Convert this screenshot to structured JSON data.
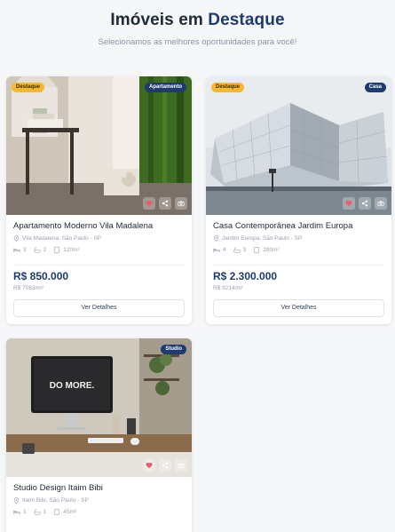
{
  "header": {
    "title_part1": "Imóveis em",
    "title_part2": "Destaque",
    "subtitle": "Selecionamos as melhores oportunidades para você!"
  },
  "colors": {
    "brand": "#1e3a6e",
    "featured_badge": "#f5b82e",
    "muted_text": "#9aa1ad"
  },
  "properties": [
    {
      "featured_label": "Destaque",
      "type_label": "Apartamento",
      "title": "Apartamento Moderno Vila Madalena",
      "location": "Vila Madalena, São Paulo - SP",
      "beds": "3",
      "baths": "2",
      "area": "120m²",
      "price": "R$ 850.000",
      "price_per_m2": "R$ 7083/m²",
      "cta": "Ver Detalhes",
      "icons": [
        "heart-icon",
        "share-icon",
        "camera-icon"
      ]
    },
    {
      "featured_label": "Destaque",
      "type_label": "Casa",
      "title": "Casa Contemporânea Jardim Europa",
      "location": "Jardim Europa, São Paulo - SP",
      "beds": "4",
      "baths": "3",
      "area": "280m²",
      "price": "R$ 2.300.000",
      "price_per_m2": "R$ 8214/m²",
      "cta": "Ver Detalhes",
      "icons": [
        "heart-icon",
        "share-icon",
        "camera-icon"
      ]
    },
    {
      "type_label": "Studio",
      "title": "Studio Design Itaim Bibi",
      "location": "Itaim Bibi, São Paulo - SP",
      "beds": "1",
      "baths": "1",
      "area": "45m²",
      "screen_text": "DO MORE.",
      "icons": [
        "heart-icon",
        "share-icon",
        "camera-icon"
      ]
    }
  ]
}
